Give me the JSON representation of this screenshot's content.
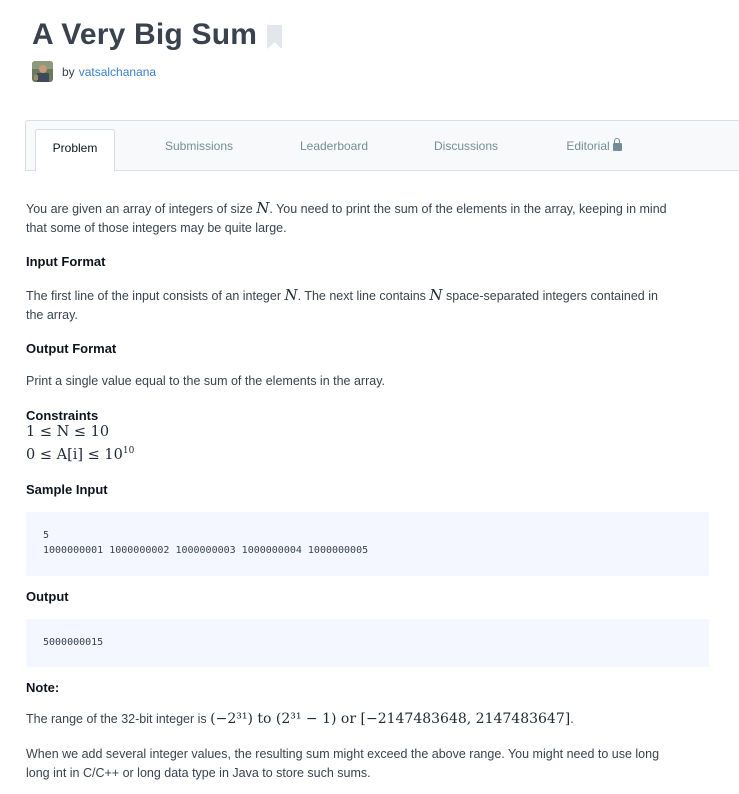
{
  "challenge": {
    "title": "A Very Big Sum",
    "by_label": "by",
    "author": "vatsalchanana"
  },
  "tabs": [
    {
      "label": "Problem",
      "active": true
    },
    {
      "label": "Submissions",
      "active": false
    },
    {
      "label": "Leaderboard",
      "active": false
    },
    {
      "label": "Discussions",
      "active": false
    },
    {
      "label": "Editorial",
      "active": false,
      "icon": "lock-icon"
    }
  ],
  "problem": {
    "intro_1": "You are given an array of integers of size ",
    "intro_var": "N",
    "intro_2": ". You need to print the sum of the elements in the array, keeping in mind",
    "intro_3": "that some of those integers may be quite large.",
    "input_heading": "Input Format",
    "input_1": "The first line of the input consists of an integer ",
    "input_var1": "N",
    "input_2": ". The next line contains ",
    "input_var2": "N",
    "input_3": " space-separated integers contained in",
    "input_4": "the array.",
    "output_heading": "Output Format",
    "output_text": "Print a single value equal to the sum of the elements in the array.",
    "constraints_heading": "Constraints",
    "constraint_1": "1 ≤ N ≤ 10",
    "constraint_2_base": "0 ≤ A[i] ≤ 10",
    "constraint_2_exp": "10",
    "sample_input_heading": "Sample Input",
    "sample_input_lines": [
      "5",
      "1000000001 1000000002 1000000003 1000000004 1000000005"
    ],
    "sample_output_heading": "Output",
    "sample_output_lines": [
      "5000000015"
    ],
    "note_heading": "Note:",
    "note_range_prefix": "The range of the 32-bit integer is ",
    "note_range_math": "(−2³¹) to (2³¹ − 1) or [−2147483648, 2147483647]",
    "note_range_suffix": ".",
    "note_sum_1": "When we add several integer values, the resulting sum might exceed the above range. You might need to use long",
    "note_sum_2": "long int in C/C++ or long data type in Java to store such sums."
  },
  "colors": {
    "text": "#39424e",
    "author_link": "#3c7dc4",
    "tab_inactive": "#738f93",
    "code_bg": "#f4f7ff"
  }
}
